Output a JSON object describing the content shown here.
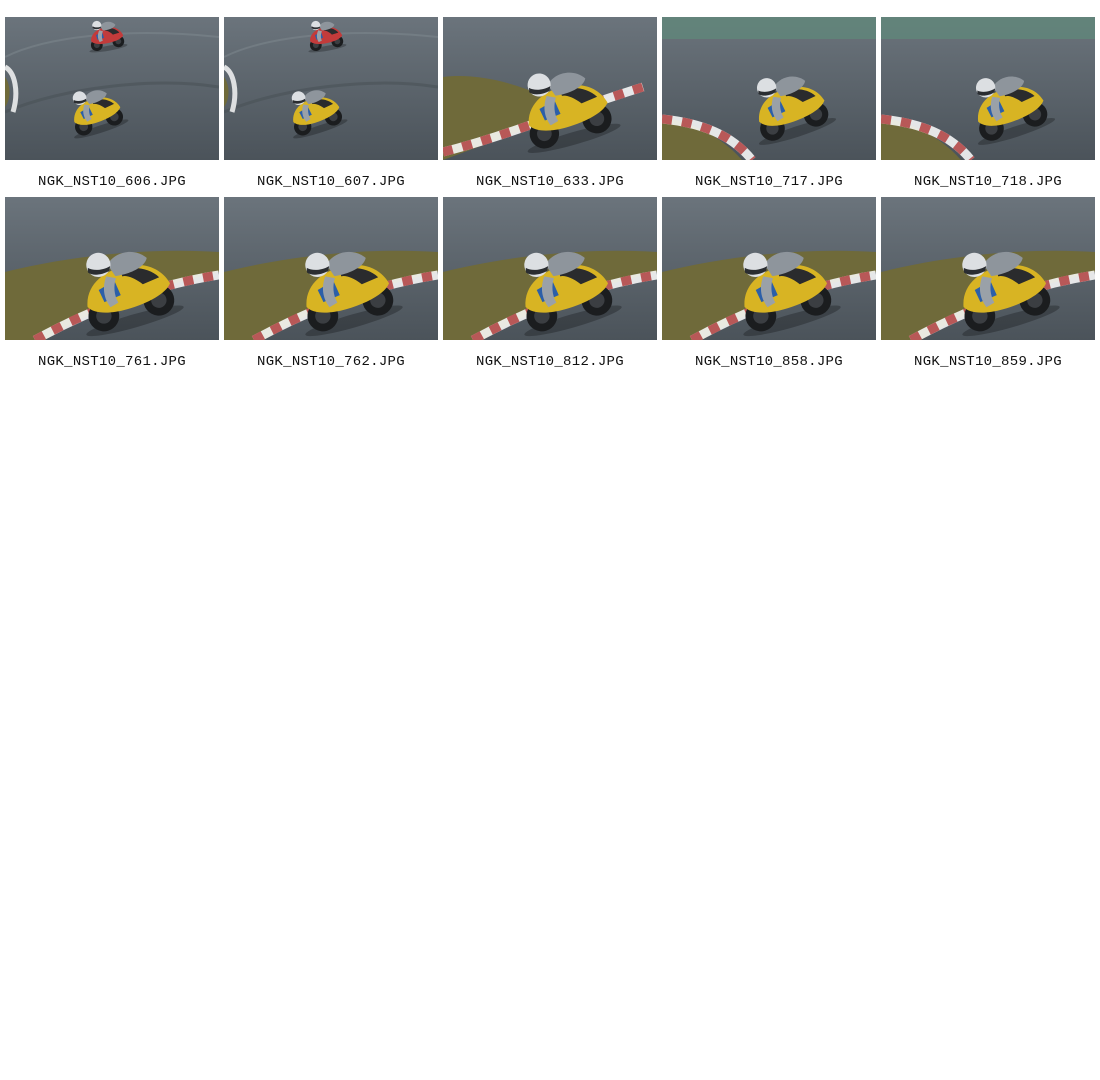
{
  "gallery": {
    "photos": [
      {
        "filename": "NGK_NST10_606.JPG",
        "scene": "wide-two-riders"
      },
      {
        "filename": "NGK_NST10_607.JPG",
        "scene": "wide-two-riders"
      },
      {
        "filename": "NGK_NST10_633.JPG",
        "scene": "close-kerb"
      },
      {
        "filename": "NGK_NST10_717.JPG",
        "scene": "mid-kerb-green"
      },
      {
        "filename": "NGK_NST10_718.JPG",
        "scene": "mid-kerb-green"
      },
      {
        "filename": "NGK_NST10_761.JPG",
        "scene": "close-grass"
      },
      {
        "filename": "NGK_NST10_762.JPG",
        "scene": "close-grass"
      },
      {
        "filename": "NGK_NST10_812.JPG",
        "scene": "close-grass"
      },
      {
        "filename": "NGK_NST10_858.JPG",
        "scene": "close-grass"
      },
      {
        "filename": "NGK_NST10_859.JPG",
        "scene": "close-grass"
      }
    ]
  },
  "colors": {
    "asphalt": "#5a636b",
    "grass": "#6f6a3a",
    "bike_yellow": "#d8b423",
    "kerb_red": "#b24848",
    "rider_white": "#dcdfe2",
    "trackside_green": "#5f8a7a"
  }
}
